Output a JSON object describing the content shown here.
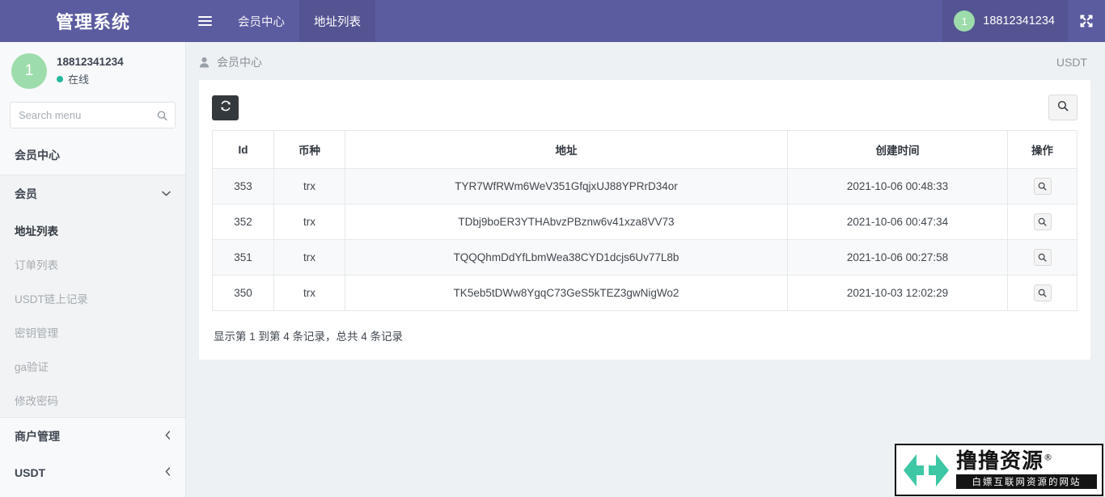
{
  "navbar": {
    "brand": "管理系统",
    "burger_icon": "hamburger-menu-icon",
    "tabs": [
      {
        "label": "会员中心",
        "active": false
      },
      {
        "label": "地址列表",
        "active": true
      }
    ],
    "user": {
      "avatar_text": "1",
      "name": "18812341234"
    },
    "expand_icon": "fullscreen-expand-icon"
  },
  "sidebar": {
    "profile": {
      "avatar_text": "1",
      "phone": "18812341234",
      "status": "在线",
      "status_color": "#23b99a"
    },
    "search": {
      "placeholder": "Search menu",
      "value": "",
      "icon": "search-icon"
    },
    "items": [
      {
        "label": "会员中心",
        "type": "header"
      },
      {
        "label": "会员",
        "type": "group",
        "chevron": "chevron-down-icon"
      },
      {
        "label": "地址列表",
        "type": "sub",
        "active": true
      },
      {
        "label": "订单列表",
        "type": "sub",
        "active": false
      },
      {
        "label": "USDT链上记录",
        "type": "sub",
        "active": false
      },
      {
        "label": "密钥管理",
        "type": "sub",
        "active": false
      },
      {
        "label": "ga验证",
        "type": "sub",
        "active": false
      },
      {
        "label": "修改密码",
        "type": "sub",
        "active": false
      },
      {
        "label": "商户管理",
        "type": "section",
        "chevron": "chevron-left-icon"
      },
      {
        "label": "USDT",
        "type": "section",
        "chevron": "chevron-left-icon"
      }
    ]
  },
  "content": {
    "breadcrumb": {
      "icon": "user-icon",
      "text": "会员中心"
    },
    "breadcrumb_right": "USDT",
    "toolbar": {
      "refresh_label": "refresh-icon",
      "search_label": "search-icon"
    },
    "table": {
      "columns": [
        "Id",
        "币种",
        "地址",
        "创建时间",
        "操作"
      ],
      "rows": [
        {
          "id": "353",
          "coin": "trx",
          "address": "TYR7WfRWm6WeV351GfqjxUJ88YPRrD34or",
          "created": "2021-10-06 00:48:33",
          "action_icon": "search-icon"
        },
        {
          "id": "352",
          "coin": "trx",
          "address": "TDbj9boER3YTHAbvzPBznw6v41xza8VV73",
          "created": "2021-10-06 00:47:34",
          "action_icon": "search-icon"
        },
        {
          "id": "351",
          "coin": "trx",
          "address": "TQQQhmDdYfLbmWea38CYD1dcjs6Uv77L8b",
          "created": "2021-10-06 00:27:58",
          "action_icon": "search-icon"
        },
        {
          "id": "350",
          "coin": "trx",
          "address": "TK5eb5tDWw8YgqC73GeS5kTEZ3gwNigWo2",
          "created": "2021-10-03 12:02:29",
          "action_icon": "search-icon"
        }
      ],
      "footer_note": "显示第 1 到第 4 条记录，总共 4 条记录"
    }
  },
  "watermark": {
    "main_text": "撸撸资源",
    "registered_mark": "®",
    "sub_text": "白嫖互联网资源的网站",
    "logo_color": "#3ec7a5"
  },
  "theme": {
    "navbar_bg": "#5b5ba0",
    "navbar_active_bg": "#545492",
    "avatar_green": "#9ddcab",
    "content_bg": "#edf1f3",
    "panel_bg": "#ffffff"
  }
}
